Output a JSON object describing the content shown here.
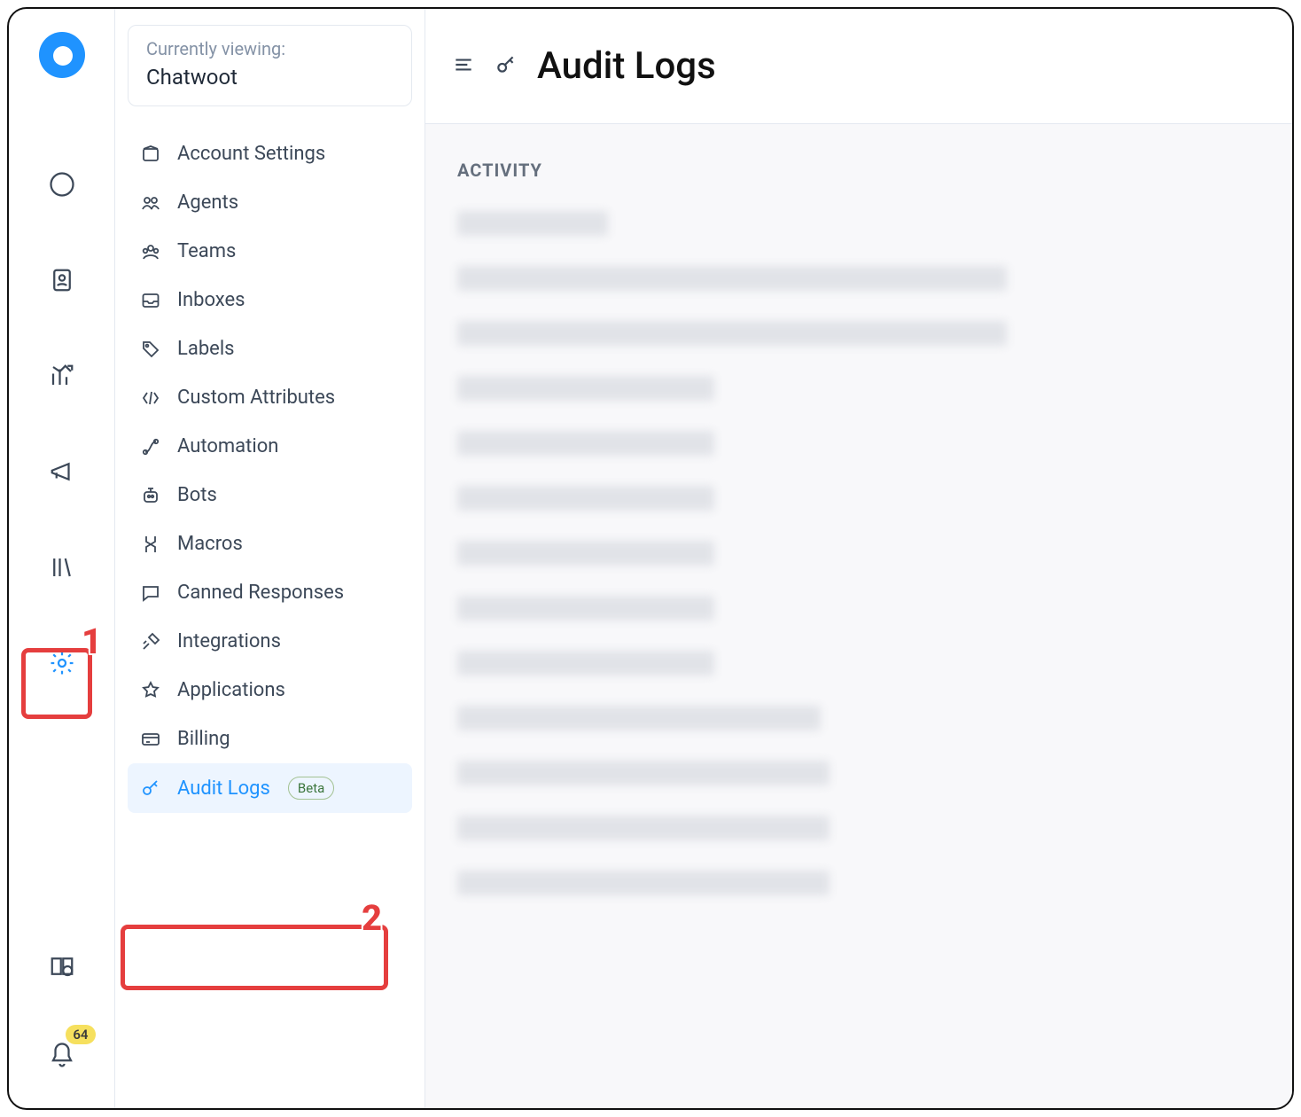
{
  "account_switcher": {
    "label": "Currently viewing:",
    "name": "Chatwoot"
  },
  "page": {
    "title": "Audit Logs",
    "section": "ACTIVITY"
  },
  "settings_nav": [
    {
      "key": "account-settings",
      "label": "Account Settings"
    },
    {
      "key": "agents",
      "label": "Agents"
    },
    {
      "key": "teams",
      "label": "Teams"
    },
    {
      "key": "inboxes",
      "label": "Inboxes"
    },
    {
      "key": "labels",
      "label": "Labels"
    },
    {
      "key": "custom-attributes",
      "label": "Custom Attributes"
    },
    {
      "key": "automation",
      "label": "Automation"
    },
    {
      "key": "bots",
      "label": "Bots"
    },
    {
      "key": "macros",
      "label": "Macros"
    },
    {
      "key": "canned-responses",
      "label": "Canned Responses"
    },
    {
      "key": "integrations",
      "label": "Integrations"
    },
    {
      "key": "applications",
      "label": "Applications"
    },
    {
      "key": "billing",
      "label": "Billing"
    },
    {
      "key": "audit-logs",
      "label": "Audit Logs",
      "badge": "Beta",
      "active": true
    }
  ],
  "rail": {
    "notifications_count": "64"
  },
  "annotations": {
    "one": "1",
    "two": "2"
  },
  "activity_row_widths": [
    170,
    620,
    620,
    290,
    290,
    290,
    290,
    290,
    290,
    410,
    420,
    420,
    420
  ]
}
